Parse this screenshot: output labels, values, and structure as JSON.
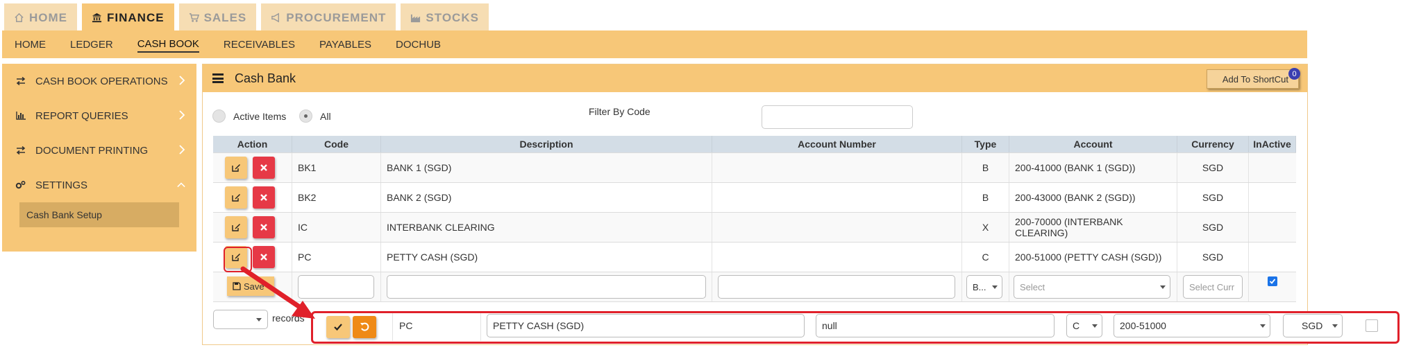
{
  "module_tabs": [
    {
      "label": "HOME",
      "icon": "home-icon",
      "active": false
    },
    {
      "label": "FINANCE",
      "icon": "bank-icon",
      "active": true
    },
    {
      "label": "SALES",
      "icon": "cart-icon",
      "active": false
    },
    {
      "label": "PROCUREMENT",
      "icon": "bullhorn-icon",
      "active": false
    },
    {
      "label": "STOCKS",
      "icon": "factory-icon",
      "active": false
    }
  ],
  "subnav": [
    "HOME",
    "LEDGER",
    "CASH BOOK",
    "RECEIVABLES",
    "PAYABLES",
    "DOCHUB"
  ],
  "subnav_active": "CASH BOOK",
  "sidebar": {
    "items": [
      {
        "label": "CASH BOOK OPERATIONS",
        "icon": "exchange-icon",
        "expanded": false
      },
      {
        "label": "REPORT QUERIES",
        "icon": "bar-chart-icon",
        "expanded": false
      },
      {
        "label": "DOCUMENT PRINTING",
        "icon": "exchange-icon",
        "expanded": false
      },
      {
        "label": "SETTINGS",
        "icon": "cogs-icon",
        "expanded": true
      }
    ],
    "sub_item": "Cash Bank Setup"
  },
  "panel": {
    "title": "Cash Bank",
    "shortcut_label": "Add To ShortCut",
    "shortcut_count": "0",
    "radio_active": "Active Items",
    "radio_all": "All",
    "filter_label": "Filter By Code"
  },
  "table": {
    "headers": [
      "Action",
      "Code",
      "Description",
      "Account Number",
      "Type",
      "Account",
      "Currency",
      "InActive"
    ],
    "rows": [
      {
        "code": "BK1",
        "description": "BANK 1 (SGD)",
        "account_number": "",
        "type": "B",
        "account": "200-41000 (BANK 1 (SGD))",
        "currency": "SGD"
      },
      {
        "code": "BK2",
        "description": "BANK 2 (SGD)",
        "account_number": "",
        "type": "B",
        "account": "200-43000 (BANK 2 (SGD))",
        "currency": "SGD"
      },
      {
        "code": "IC",
        "description": "INTERBANK CLEARING",
        "account_number": "",
        "type": "X",
        "account": "200-70000 (INTERBANK CLEARING)",
        "currency": "SGD"
      },
      {
        "code": "PC",
        "description": "PETTY CASH (SGD)",
        "account_number": "",
        "type": "C",
        "account": "200-51000 (PETTY CASH (SGD))",
        "currency": "SGD"
      }
    ],
    "new_row": {
      "save_label": "Save",
      "type_value": "B...",
      "account_placeholder": "Select",
      "currency_placeholder": "Select Curr"
    },
    "records_label": "records"
  },
  "edit_row": {
    "code": "PC",
    "description": "PETTY CASH (SGD)",
    "account_number": "null",
    "type": "C",
    "account": "200-51000",
    "currency": "SGD"
  },
  "colors": {
    "accent": "#f7c778",
    "accent_light": "#f6ddb3",
    "delete": "#e63946",
    "undo": "#ef8a17",
    "highlight": "#e0202a",
    "header_row": "#d3dde6"
  }
}
